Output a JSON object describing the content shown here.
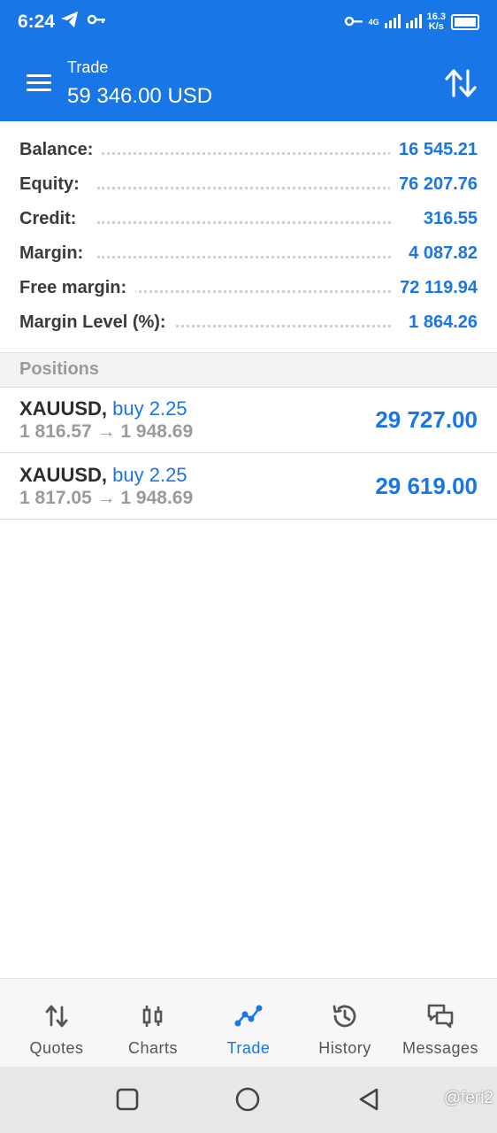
{
  "status_bar": {
    "time": "6:24",
    "network_speed_value": "16.3",
    "network_speed_unit": "K/s",
    "network_type": "4G"
  },
  "header": {
    "title": "Trade",
    "subtitle": "59 346.00 USD"
  },
  "account": [
    {
      "label": "Balance:",
      "value": "16 545.21"
    },
    {
      "label": "Equity:",
      "value": "76 207.76"
    },
    {
      "label": "Credit:",
      "value": "316.55"
    },
    {
      "label": "Margin:",
      "value": "4 087.82"
    },
    {
      "label": "Free margin:",
      "value": "72 119.94"
    },
    {
      "label": "Margin Level (%):",
      "value": "1 864.26"
    }
  ],
  "positions_section": {
    "title": "Positions"
  },
  "positions": [
    {
      "symbol": "XAUUSD,",
      "direction": "buy 2.25",
      "prices": "1 816.57 → 1 948.69",
      "profit": "29 727.00"
    },
    {
      "symbol": "XAUUSD,",
      "direction": "buy 2.25",
      "prices": "1 817.05 → 1 948.69",
      "profit": "29 619.00"
    }
  ],
  "bottom_nav": [
    {
      "label": "Quotes",
      "icon": "quotes-icon",
      "active": false
    },
    {
      "label": "Charts",
      "icon": "charts-icon",
      "active": false
    },
    {
      "label": "Trade",
      "icon": "trade-icon",
      "active": true
    },
    {
      "label": "History",
      "icon": "history-icon",
      "active": false
    },
    {
      "label": "Messages",
      "icon": "messages-icon",
      "active": false
    }
  ],
  "watermark": "@feri2",
  "colors": {
    "accent": "#1976e6",
    "value_blue": "#1976e6",
    "muted_gray": "#9a9a9a"
  }
}
